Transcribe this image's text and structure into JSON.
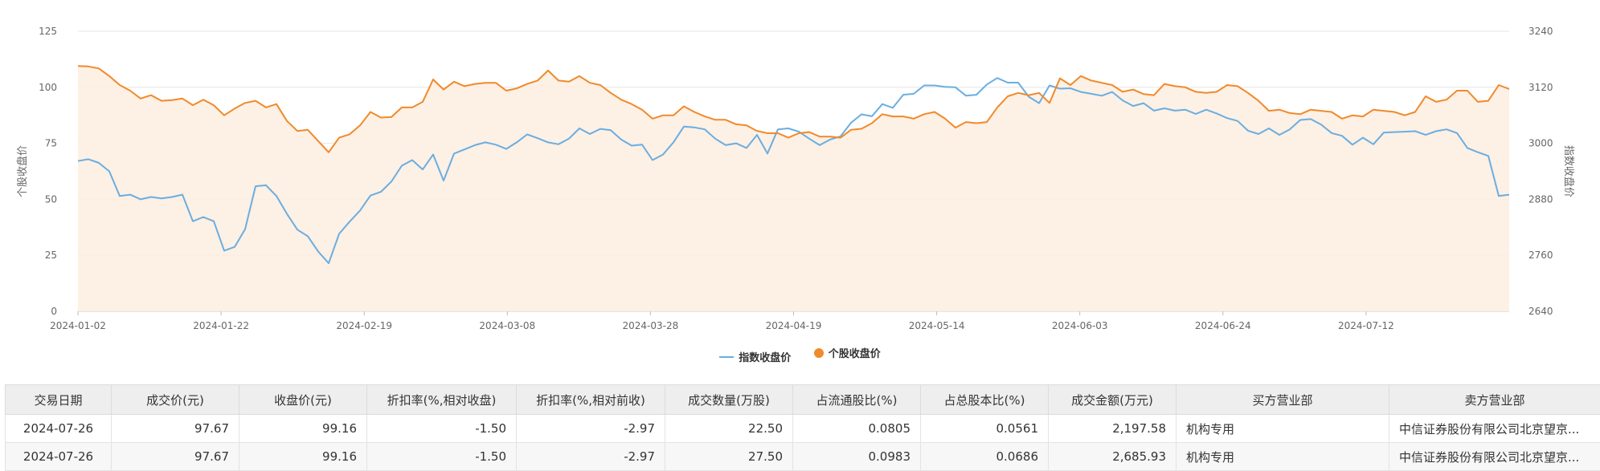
{
  "chart_data": {
    "type": "line",
    "x_ticks": [
      "2024-01-02",
      "2024-01-22",
      "2024-02-19",
      "2024-03-08",
      "2024-03-28",
      "2024-04-19",
      "2024-05-14",
      "2024-06-03",
      "2024-06-24",
      "2024-07-12"
    ],
    "y_left": {
      "label": "个股收盘价",
      "min": 0,
      "max": 125,
      "ticks": [
        0,
        25,
        50,
        75,
        100,
        125
      ]
    },
    "y_right": {
      "label": "指数收盘价",
      "min": 2640,
      "max": 3240,
      "ticks": [
        2640,
        2760,
        2880,
        3000,
        3120,
        3240
      ]
    },
    "legend_position": "bottom-center",
    "series": [
      {
        "name": "指数收盘价",
        "axis": "right",
        "color": "#6aaee0",
        "values": [
          2962,
          2966,
          2958,
          2940,
          2887,
          2890,
          2880,
          2885,
          2882,
          2885,
          2890,
          2833,
          2842,
          2833,
          2770,
          2778,
          2816,
          2908,
          2910,
          2887,
          2849,
          2815,
          2801,
          2768,
          2743,
          2806,
          2832,
          2856,
          2888,
          2896,
          2918,
          2952,
          2964,
          2944,
          2976,
          2920,
          2978,
          2987,
          2996,
          3002,
          2997,
          2988,
          3002,
          3019,
          3011,
          3002,
          2998,
          3010,
          3032,
          3020,
          3031,
          3028,
          3008,
          2995,
          2997,
          2964,
          2976,
          3002,
          3036,
          3034,
          3030,
          3010,
          2996,
          3000,
          2990,
          3018,
          2978,
          3030,
          3032,
          3025,
          3010,
          2996,
          3008,
          3015,
          3044,
          3062,
          3058,
          3084,
          3076,
          3104,
          3106,
          3124,
          3124,
          3121,
          3120,
          3102,
          3104,
          3126,
          3140,
          3130,
          3130,
          3100,
          3086,
          3124,
          3117,
          3118,
          3110,
          3106,
          3102,
          3110,
          3092,
          3080,
          3086,
          3070,
          3075,
          3070,
          3072,
          3063,
          3072,
          3064,
          3054,
          3048,
          3027,
          3020,
          3032,
          3018,
          3030,
          3050,
          3052,
          3040,
          3022,
          3016,
          2997,
          3012,
          2998,
          3023,
          3024,
          3025,
          3026,
          3018,
          3026,
          3030,
          3022,
          2990,
          2981,
          2973,
          2887,
          2890
        ]
      },
      {
        "name": "个股收盘价",
        "axis": "left",
        "color": "#f08a2a",
        "values": [
          109.5,
          109.3,
          108.4,
          105.0,
          101.0,
          98.5,
          95.0,
          96.5,
          94.0,
          94.3,
          95.0,
          92.0,
          94.5,
          92.0,
          87.5,
          90.5,
          93.0,
          94.0,
          91.0,
          92.5,
          85.0,
          80.5,
          81.0,
          76.0,
          71.0,
          77.5,
          79.0,
          83.0,
          89.0,
          86.5,
          86.7,
          91.0,
          91.0,
          93.5,
          103.5,
          99.0,
          102.5,
          100.5,
          101.5,
          102.0,
          102.0,
          98.5,
          99.5,
          101.5,
          103.0,
          107.5,
          103.0,
          102.5,
          105.0,
          102.0,
          101.0,
          97.5,
          94.5,
          92.5,
          90.0,
          86.0,
          87.5,
          87.5,
          91.5,
          89.0,
          87.0,
          85.5,
          85.5,
          83.5,
          83.0,
          80.5,
          79.5,
          79.5,
          77.5,
          79.5,
          80.0,
          78.0,
          78.0,
          77.5,
          81.0,
          81.5,
          84.0,
          88.0,
          87.0,
          87.0,
          86.0,
          88.0,
          89.0,
          86.0,
          82.0,
          84.5,
          84.0,
          84.5,
          91.0,
          96.0,
          97.5,
          96.5,
          97.5,
          93.0,
          104.0,
          101.0,
          105.0,
          103.0,
          102.0,
          101.0,
          98.0,
          99.0,
          97.0,
          96.5,
          101.5,
          100.5,
          100.0,
          98.0,
          97.5,
          98.0,
          101.0,
          100.5,
          97.5,
          94.0,
          89.5,
          90.0,
          88.5,
          88.0,
          90.0,
          89.5,
          89.0,
          86.0,
          87.5,
          87.0,
          90.0,
          89.5,
          89.0,
          87.5,
          89.0,
          96.0,
          93.5,
          94.5,
          98.5,
          98.5,
          93.5,
          94.0,
          101.0,
          99.2
        ]
      }
    ]
  },
  "table": {
    "columns": [
      "交易日期",
      "成交价(元)",
      "收盘价(元)",
      "折扣率(%,相对收盘)",
      "折扣率(%,相对前收)",
      "成交数量(万股)",
      "占流通股比(%)",
      "占总股本比(%)",
      "成交金额(万元)",
      "买方营业部",
      "卖方营业部"
    ],
    "rows": [
      [
        "2024-07-26",
        "97.67",
        "99.16",
        "-1.50",
        "-2.97",
        "22.50",
        "0.0805",
        "0.0561",
        "2,197.58",
        "机构专用",
        "中信证券股份有限公司北京望京..."
      ],
      [
        "2024-07-26",
        "97.67",
        "99.16",
        "-1.50",
        "-2.97",
        "27.50",
        "0.0983",
        "0.0686",
        "2,685.93",
        "机构专用",
        "中信证券股份有限公司北京望京..."
      ]
    ]
  }
}
